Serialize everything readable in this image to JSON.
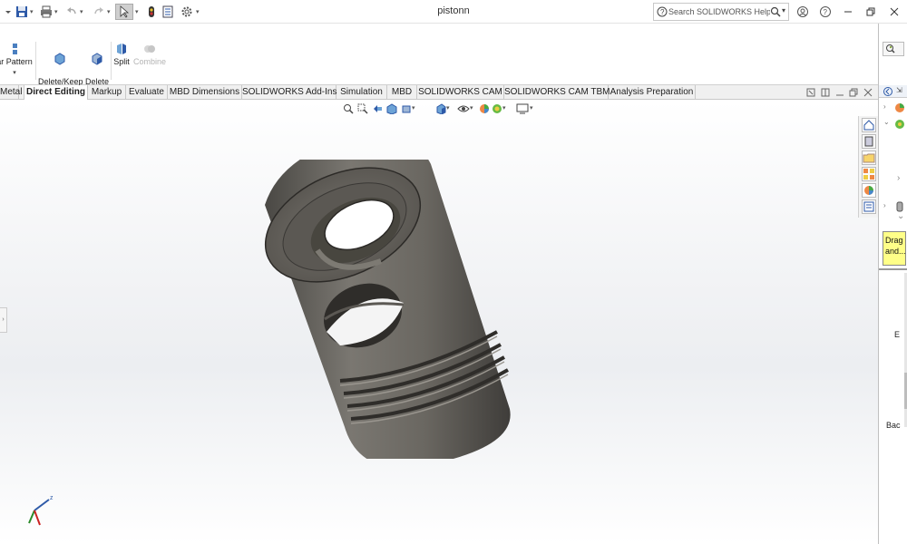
{
  "document": {
    "title": "pistonn"
  },
  "help_search": {
    "placeholder": "Search SOLIDWORKS Help"
  },
  "ribbon": {
    "partial_pattern_label": "ar Pattern",
    "delete_keep_body_label": "Delete/Keep\nBody",
    "delete_face_label": "Delete\nFace",
    "split_label": "Split",
    "combine_label": "Combine"
  },
  "tabs": [
    {
      "label": "Metal"
    },
    {
      "label": "Direct Editing",
      "active": true
    },
    {
      "label": "Markup"
    },
    {
      "label": "Evaluate"
    },
    {
      "label": "MBD Dimensions"
    },
    {
      "label": "SOLIDWORKS Add-Ins"
    },
    {
      "label": "Simulation"
    },
    {
      "label": "MBD"
    },
    {
      "label": "SOLIDWORKS CAM"
    },
    {
      "label": "SOLIDWORKS CAM TBM"
    },
    {
      "label": "Analysis Preparation"
    }
  ],
  "task_pane": {
    "tooltip_text": "Drag and...",
    "side_label_1": "E",
    "side_label_2": "Bac"
  },
  "triad": {
    "z_label": "z"
  },
  "colors": {
    "piston_body": "#5f5c57",
    "accent_blue": "#1f6fc5",
    "tooltip_bg": "#ffff88"
  },
  "icons": [
    "save-icon",
    "print-icon",
    "undo-icon",
    "redo-icon",
    "select-icon",
    "rebuild-icon",
    "file-properties-icon",
    "options-icon",
    "help-search-icon",
    "user-icon",
    "help-icon",
    "minimize-icon",
    "restore-icon",
    "close-icon"
  ]
}
